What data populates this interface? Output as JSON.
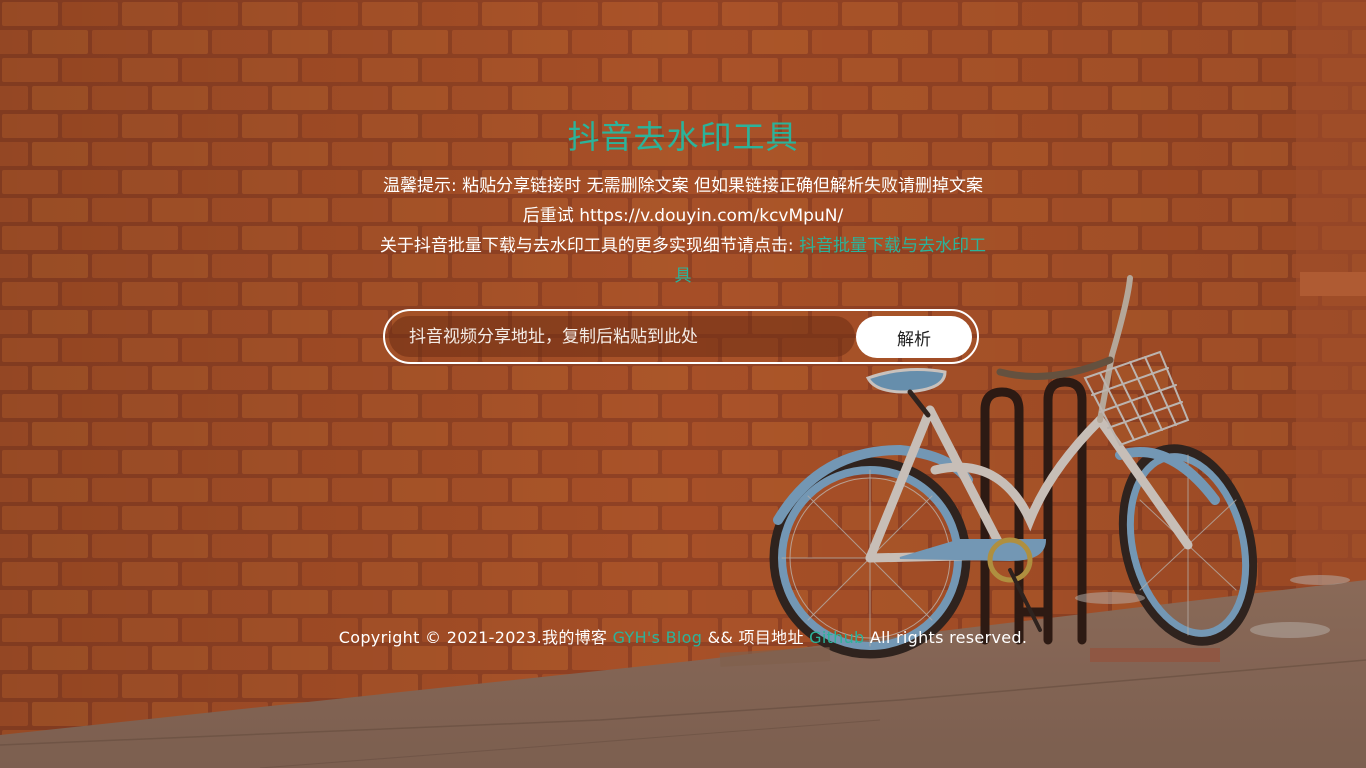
{
  "page": {
    "title": "抖音去水印工具"
  },
  "tips": {
    "line1": "温馨提示: 粘贴分享链接时 无需删除文案 但如果链接正确但解析失败请删掉文案后重试 https://v.douyin.com/kcvMpuN/",
    "line2_prefix": "关于抖音批量下载与去水印工具的更多实现细节请点击: ",
    "line2_link": "抖音批量下载与去水印工具"
  },
  "search": {
    "placeholder": "抖音视频分享地址，复制后粘贴到此处",
    "value": "",
    "button_label": "解析"
  },
  "footer": {
    "prefix": "Copyright © 2021-2023.我的博客 ",
    "blog_link": "GYH's Blog",
    "middle": " && 项目地址 ",
    "github_link": "Github",
    "suffix": " All rights reserved."
  },
  "colors": {
    "accent": "#2bb39a",
    "brick": "#b8562f",
    "text": "#ffffff"
  }
}
